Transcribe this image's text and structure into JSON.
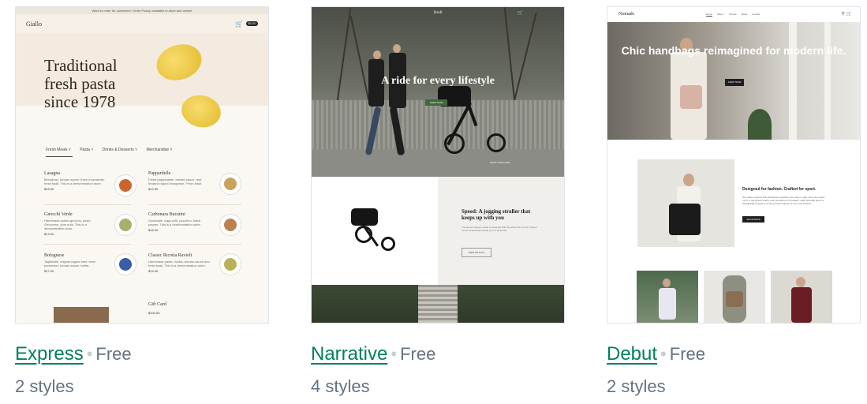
{
  "cards": [
    {
      "name": "Express",
      "price": "Free",
      "styles": "2 styles",
      "preview": {
        "announcement": "Want to order for ourselves? Order Pickup available in-store and online!",
        "logo": "Giallo",
        "cart_badge": "$0.00",
        "hero_heading": "Traditional fresh pasta since 1978",
        "tabs": [
          "Fresh Meals ˅",
          "Pasta ˅",
          "Drinks & Desserts ˅",
          "Merchandise ˅"
        ],
        "menu_items": [
          {
            "name": "Lasagna",
            "desc": "Béchamel, tomato sauce, fresh mozzarella, fresh basil. This is a demonstration store.",
            "price": "$15.00"
          },
          {
            "name": "Pappardelle",
            "desc": "Fresh pappardelle, tomato sauce, and braised ragout bolognese. Fresh basil.",
            "price": "$12.00"
          },
          {
            "name": "Gnocchi Verde",
            "desc": "Handmade potato gnocchi, pesto Genovese, pine nuts. This is a demonstration store.",
            "price": "$13.00"
          },
          {
            "name": "Carbonara Bucatini",
            "desc": "Guanciale, eggs yolk, pecorino, black pepper. This is a demonstration store.",
            "price": "$16.00"
          },
          {
            "name": "Bolognese",
            "desc": "Tagliatelle, original ragout beef, fresh parmesan, tomato sauce, herbs.",
            "price": "$17.00"
          },
          {
            "name": "Classic Ricotta Ravioli",
            "desc": "Handmade pasta, ricotta, tomato sauce and fresh basil. This is a demonstration store.",
            "price": "$14.00"
          }
        ],
        "gift_card": "Gift Card",
        "gift_price": "$100.00"
      }
    },
    {
      "name": "Narrative",
      "price": "Free",
      "styles": "4 styles",
      "preview": {
        "logo": "Stroll",
        "hero_title": "A ride for every lifestyle",
        "hero_button": "SHOP NOW",
        "shop_link": "SHOP STROLLER",
        "product_title": "Speed: A jogging stroller that keeps up with you",
        "product_desc": "The all-new Speed model is designed with the active life in mind. Speed moves seamlessly beside you on all terrain.",
        "product_button": "VIEW DETAILS"
      }
    },
    {
      "name": "Debut",
      "price": "Free",
      "styles": "2 styles",
      "preview": {
        "logo": "Nomads",
        "nav": [
          "Home",
          "Shop ˅",
          "Stories",
          "About",
          "Contact"
        ],
        "hero_title": "Chic handbags reimagined for modern life.",
        "hero_button": "SHOP NOW",
        "feature_title": "Designed for fashion. Crafted for sport.",
        "feature_desc": "We make products that effortlessly transition from day to night. From the board room to the fitness studio, and everywhere in between, each Nomads piece is thoughtfully created to be the perfect balance of form and function.",
        "feature_button": "SHOP BAGS"
      }
    }
  ],
  "separator": "•",
  "colors": {
    "link": "#008060",
    "muted": "#637381",
    "dot": "#c4cdd5"
  }
}
